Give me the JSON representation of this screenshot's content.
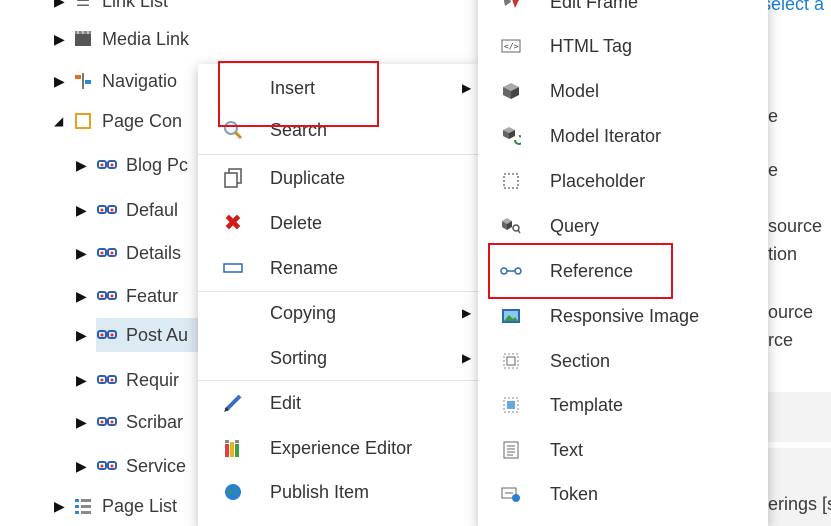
{
  "tree": {
    "items": [
      {
        "label": "Link List",
        "expanded": false
      },
      {
        "label": "Media Link",
        "expanded": false
      },
      {
        "label": "Navigatio",
        "expanded": false
      },
      {
        "label": "Page Con",
        "expanded": true
      },
      {
        "label": "Blog Pc",
        "expanded": false
      },
      {
        "label": "Defaul",
        "expanded": false
      },
      {
        "label": "Details",
        "expanded": false
      },
      {
        "label": "Featur",
        "expanded": false
      },
      {
        "label": "Post Au",
        "expanded": false,
        "selected": true
      },
      {
        "label": "Requir",
        "expanded": false
      },
      {
        "label": "Scribar",
        "expanded": false
      },
      {
        "label": "Service",
        "expanded": false
      },
      {
        "label": "Page List",
        "expanded": false
      }
    ]
  },
  "context_menu": {
    "items": [
      {
        "label": "Insert",
        "icon": "none",
        "has_submenu": true
      },
      {
        "label": "Search",
        "icon": "magnifier-icon"
      },
      {
        "label": "Duplicate",
        "icon": "duplicate-icon"
      },
      {
        "label": "Delete",
        "icon": "delete-x-icon"
      },
      {
        "label": "Rename",
        "icon": "rename-icon"
      },
      {
        "label": "Copying",
        "icon": "none",
        "has_submenu": true
      },
      {
        "label": "Sorting",
        "icon": "none",
        "has_submenu": true
      },
      {
        "label": "Edit",
        "icon": "pencil-icon"
      },
      {
        "label": "Experience Editor",
        "icon": "experience-editor-icon"
      },
      {
        "label": "Publish Item",
        "icon": "globe-icon"
      }
    ]
  },
  "insert_submenu": {
    "items": [
      {
        "label": "Edit Frame",
        "icon": "edit-frame-icon"
      },
      {
        "label": "HTML Tag",
        "icon": "html-tag-icon"
      },
      {
        "label": "Model",
        "icon": "cube-icon"
      },
      {
        "label": "Model Iterator",
        "icon": "model-iterator-icon"
      },
      {
        "label": "Placeholder",
        "icon": "placeholder-icon"
      },
      {
        "label": "Query",
        "icon": "query-icon"
      },
      {
        "label": "Reference",
        "icon": "reference-icon"
      },
      {
        "label": "Responsive Image",
        "icon": "image-icon"
      },
      {
        "label": "Section",
        "icon": "section-icon"
      },
      {
        "label": "Template",
        "icon": "template-icon"
      },
      {
        "label": "Text",
        "icon": "text-icon"
      },
      {
        "label": "Token",
        "icon": "token-icon"
      }
    ]
  },
  "right_panel": {
    "select_link": "select a",
    "fragments": [
      "e",
      "e",
      "source",
      "tion",
      "ource",
      "rce",
      "erings [s"
    ]
  },
  "colors": {
    "selection": "#dceaf4",
    "highlight_border": "#e0111b",
    "link": "#1a7fd4"
  }
}
